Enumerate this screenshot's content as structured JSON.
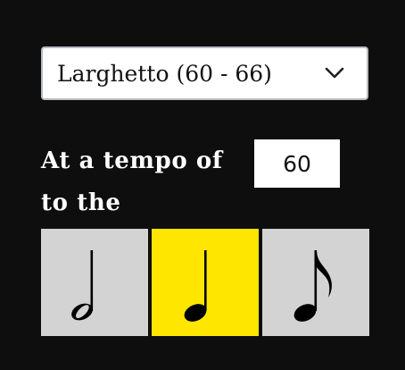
{
  "tempo_select": {
    "value": "Larghetto (60 - 66)",
    "icon": "chevron-down-icon"
  },
  "prompt": {
    "line1": "At a tempo of",
    "line2": "to the"
  },
  "bpm_input": {
    "value": "60"
  },
  "note_buttons": [
    {
      "icon": "half-note-icon",
      "selected": false
    },
    {
      "icon": "quarter-note-icon",
      "selected": true
    },
    {
      "icon": "eighth-note-icon",
      "selected": false
    }
  ],
  "colors": {
    "background": "#0e0e0e",
    "selected": "#ffe600",
    "unselected": "#d3d3d3",
    "text": "#ffffff"
  }
}
